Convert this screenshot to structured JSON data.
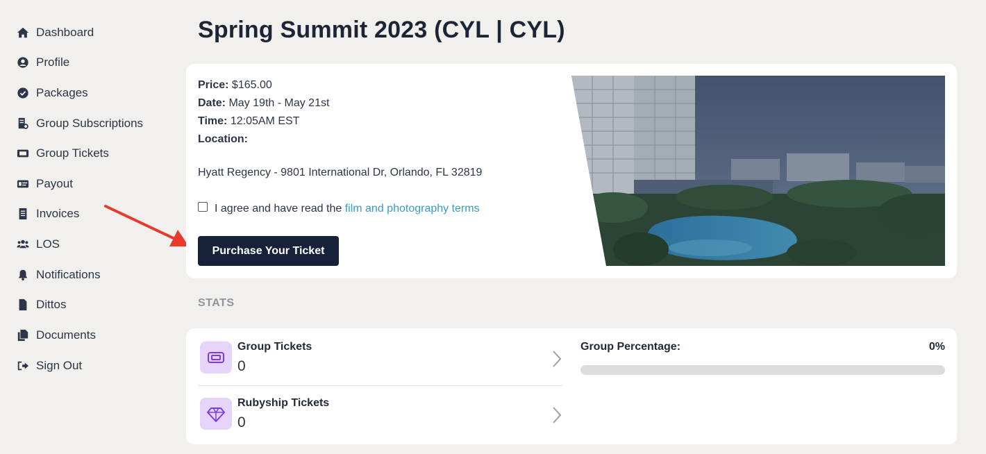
{
  "sidebar": {
    "items": [
      {
        "label": "Dashboard",
        "icon": "home-icon"
      },
      {
        "label": "Profile",
        "icon": "user-circle-icon"
      },
      {
        "label": "Packages",
        "icon": "check-circle-icon"
      },
      {
        "label": "Group Subscriptions",
        "icon": "file-invoice-icon"
      },
      {
        "label": "Group Tickets",
        "icon": "ticket-icon"
      },
      {
        "label": "Payout",
        "icon": "money-card-icon"
      },
      {
        "label": "Invoices",
        "icon": "receipt-icon"
      },
      {
        "label": "LOS",
        "icon": "users-icon"
      },
      {
        "label": "Notifications",
        "icon": "bell-icon"
      },
      {
        "label": "Dittos",
        "icon": "file-icon"
      },
      {
        "label": "Documents",
        "icon": "copy-icon"
      },
      {
        "label": "Sign Out",
        "icon": "sign-out-icon"
      }
    ]
  },
  "page": {
    "title": "Spring Summit 2023 (CYL | CYL)"
  },
  "event": {
    "price_label": "Price:",
    "price": "$165.00",
    "date_label": "Date:",
    "date": "May 19th - May 21st",
    "time_label": "Time:",
    "time": "12:05AM EST",
    "location_label": "Location:",
    "address": "Hyatt Regency - 9801 International Dr, Orlando, FL 32819",
    "agree_text": "I agree and have read the",
    "terms_link": "film and photography terms",
    "agree_checked": false,
    "purchase_button": "Purchase Your Ticket"
  },
  "stats": {
    "section_label": "STATS",
    "group_tickets": {
      "label": "Group Tickets",
      "value": "0"
    },
    "rubyship_tickets": {
      "label": "Rubyship Tickets",
      "value": "0"
    },
    "group_percentage": {
      "label": "Group Percentage:",
      "value": "0%",
      "fraction": 0
    }
  },
  "colors": {
    "background": "#f1f0ed",
    "primary_button": "#17223a",
    "link": "#3a9bbf",
    "stat_icon_bg": "#e6d4fb",
    "stat_icon_fg": "#7c3aed",
    "annotation_arrow": "#e8392b"
  }
}
